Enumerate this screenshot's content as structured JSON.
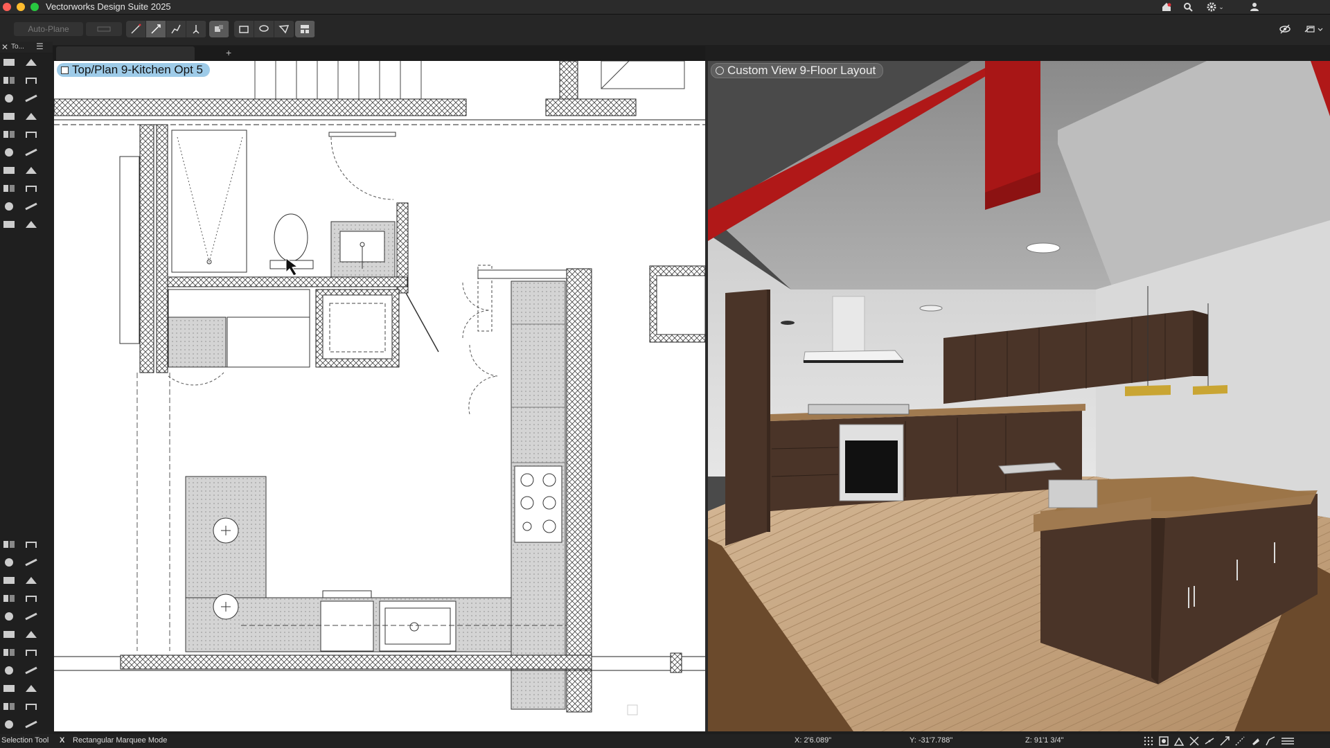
{
  "app": {
    "title": "Vectorworks Design Suite 2025"
  },
  "toolbar": {
    "auto_plane": "Auto-Plane"
  },
  "palette": {
    "title": "To..."
  },
  "plan_view": {
    "label": "Top/Plan  9-Kitchen Opt 5"
  },
  "render_view": {
    "label": "Custom View  9-Floor Layout"
  },
  "status": {
    "tool": "Selection Tool",
    "close_glyph": "X",
    "mode": "Rectangular Marquee Mode",
    "x": "X: 2'6.089\"",
    "y": "Y: -31'7.788\"",
    "z": "Z: 91'1 3/4\""
  },
  "icons": {
    "home": "home-icon",
    "search": "search-icon",
    "settings": "gear-icon",
    "user": "user-icon",
    "view_visibility": "eye-slash-icon",
    "view_options": "view-menu-icon"
  },
  "colors": {
    "accent_label_bg": "#9ecbe8",
    "steel_beam": "#b01818",
    "cabinet": "#4a3428",
    "floor": "#c4a380"
  }
}
